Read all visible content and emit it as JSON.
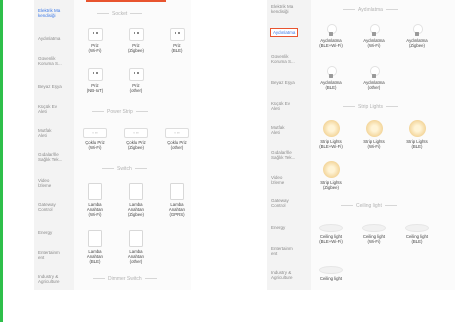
{
  "left_pane": {
    "sidebar": [
      {
        "label": "Elektrik Ma\nkendisiği",
        "active": true
      },
      {
        "label": "Aydınlatma"
      },
      {
        "label": "Güvenlik\nKoruma S..."
      },
      {
        "label": "Beyaz Eşya"
      },
      {
        "label": "Küçük Ev\nAleti"
      },
      {
        "label": "Mutfak\nAleti"
      },
      {
        "label": "Gıdalar/İle\nSağlık Tek..."
      },
      {
        "label": "Video\nİzleme"
      },
      {
        "label": "Gateway\nControl"
      },
      {
        "label": "Energy"
      },
      {
        "label": "Entertainm\nent"
      },
      {
        "label": "Industry &\nAgriculture"
      }
    ],
    "sections": [
      {
        "title": "Socket",
        "devices": [
          "Priz\n(Wi-Fi)",
          "Priz\n(Zigbee)",
          "Priz\n(BLE)",
          "Priz\n(NB-IoT)",
          "Priz\n(other)"
        ]
      },
      {
        "title": "Power Strip",
        "devices": [
          "Çoklu Priz\n(Wi-Fi)",
          "Çoklu Priz\n(Zigbee)",
          "Çoklu Priz\n(other)"
        ]
      },
      {
        "title": "Switch",
        "devices": [
          "Lamba\nAnahtarı\n(Wi-Fi)",
          "Lamba\nAnahtarı\n(Zigbee)",
          "Lamba\nAnahtarı\n(GPRS)",
          "Lamba\nAnahtarı\n(BLE)",
          "Lamba\nAnahtarı\n(other)"
        ]
      },
      {
        "title": "Dimmer Switch",
        "devices": []
      }
    ]
  },
  "right_pane": {
    "sidebar": [
      {
        "label": "Elektrik Ma\nkendisiği"
      },
      {
        "label": "Aydınlatma",
        "active": true
      },
      {
        "label": "Güvenlik\nKoruma S..."
      },
      {
        "label": "Beyaz Eşya"
      },
      {
        "label": "Küçük Ev\nAleti"
      },
      {
        "label": "Mutfak\nAleti"
      },
      {
        "label": "Gıdalar/İle\nSağlık Tek..."
      },
      {
        "label": "Video\nİzleme"
      },
      {
        "label": "Gateway\nControl"
      },
      {
        "label": "Energy"
      },
      {
        "label": "Entertainm\nent"
      },
      {
        "label": "Industry &\nAgriculture"
      }
    ],
    "sections": [
      {
        "title": "Aydınlatma",
        "devices": [
          "Aydınlatma\n(BLE+Wi-Fi)",
          "Aydınlatma\n(Wi-Fi)",
          "Aydınlatma\n(Zigbee)",
          "Aydınlatma\n(BLE)",
          "Aydınlatma\n(other)"
        ]
      },
      {
        "title": "Strip Lights",
        "devices": [
          "Strip Lights\n(BLE+Wi-Fi)",
          "Strip Lights\n(Wi-Fi)",
          "Strip Lights\n(BLE)",
          "Strip Lights\n(Zigbee)"
        ]
      },
      {
        "title": "Ceiling light",
        "devices": [
          "Ceiling light\n(BLE+Wi-Fi)",
          "Ceiling light\n(Wi-Fi)",
          "Ceiling light\n(BLE)",
          "Ceiling light"
        ]
      }
    ]
  },
  "colors": {
    "accent": "#3b78e7",
    "highlight": "#e8542f",
    "green": "#2fbf4a"
  }
}
